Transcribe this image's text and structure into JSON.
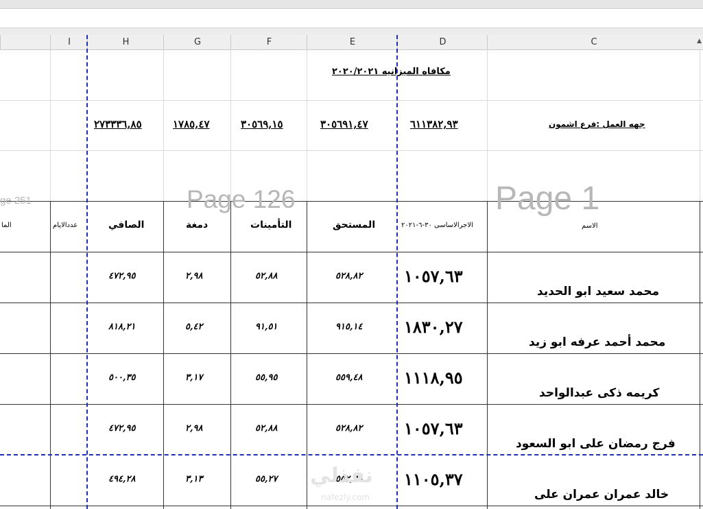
{
  "columns": [
    "I",
    "H",
    "G",
    "F",
    "E",
    "D",
    "C"
  ],
  "sheet": {
    "title": "مكافاه الميزانيه ٢٠٢٠/٢٠٢١",
    "workplace": "جهه العمل :فرع اشمون",
    "totals": {
      "D": "٦١١٣٨٢,٩٣",
      "E": "٣٠٥٦٩١,٤٧",
      "F": "٣٠٥٦٩,١٥",
      "G": "١٧٨٥,٤٧",
      "H": "٢٧٣٣٣٦,٨٥"
    },
    "watermarks": {
      "page1": "Page 1",
      "page126": "Page 126",
      "page251": "ge 251"
    },
    "headers": {
      "C": "الاسم",
      "D": "الاجرالاساسى ٣٠-٦-٢٠٢١",
      "E": "المستحق",
      "F": "التأمينات",
      "G": "دمغة",
      "H": "الصافي",
      "I": "عددالايام",
      "J": "الما"
    },
    "rows": [
      {
        "name": "محمد سعيد ابو الحديد",
        "basic": "١٠٥٧,٦٣",
        "due": "٥٢٨,٨٢",
        "insurance": "٥٢,٨٨",
        "stamp": "٢,٩٨",
        "net": "٤٧٢,٩٥"
      },
      {
        "name": "محمد أحمد عرفه ابو زيد",
        "basic": "١٨٣٠,٢٧",
        "due": "٩١٥,١٤",
        "insurance": "٩١,٥١",
        "stamp": "٥,٤٢",
        "net": "٨١٨,٢١"
      },
      {
        "name": "كريمه ذكى عبدالواحد",
        "basic": "١١١٨,٩٥",
        "due": "٥٥٩,٤٨",
        "insurance": "٥٥,٩٥",
        "stamp": "٣,١٧",
        "net": "٥٠٠,٣٥"
      },
      {
        "name": "فرج رمضان على ابو السعود",
        "basic": "١٠٥٧,٦٣",
        "due": "٥٢٨,٨٢",
        "insurance": "٥٢,٨٨",
        "stamp": "٢,٩٨",
        "net": "٤٧٢,٩٥"
      },
      {
        "name": "خالد عمران عمران على",
        "basic": "١١٠٥,٣٧",
        "due": "٥٥٢,٦٩",
        "insurance": "٥٥,٢٧",
        "stamp": "٣,١٣",
        "net": "٤٩٤,٢٨"
      }
    ],
    "site_watermark": {
      "brand": "نفذلي",
      "url": "nafezly.com"
    }
  },
  "colors": {
    "page_break": "#1f2fb3",
    "grid": "#d9d9d9",
    "header_bg": "#efefef"
  }
}
